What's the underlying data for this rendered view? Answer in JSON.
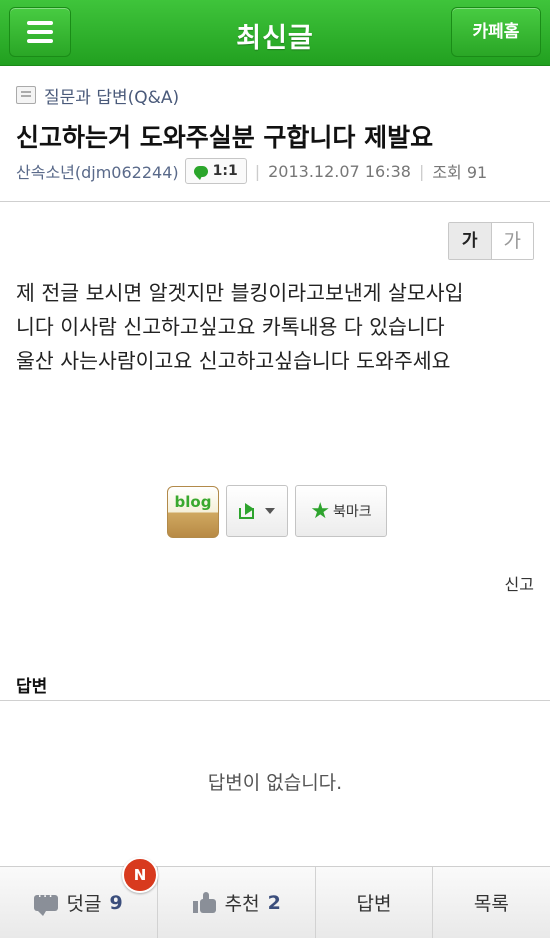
{
  "header": {
    "title": "최신글",
    "home_label": "카페홈"
  },
  "post": {
    "category": "질문과 답변(Q&A)",
    "title": "신고하는거 도와주실분 구합니다 제발요",
    "author": "산속소년(djm062244)",
    "chat_label": "1:1",
    "date": "2013.12.07 16:38",
    "views_label": "조회 91",
    "font_small": "가",
    "font_large": "가",
    "body_lines": [
      "제 전글 보시면 알겟지만 블킹이라고보낸게 살모사입",
      "니다 이사람 신고하고싶고요 카톡내용 다 있습니다",
      "울산 사는사람이고요 신고하고싶습니다 도와주세요"
    ],
    "blog_label": "blog",
    "bookmark_label": "북마크",
    "report_label": "신고"
  },
  "answers": {
    "title": "답변",
    "empty_text": "답변이 없습니다."
  },
  "bottom_bar": {
    "comments_label": "덧글",
    "comments_count": "9",
    "new_badge": "N",
    "recommend_label": "추천",
    "recommend_count": "2",
    "answer_label": "답변",
    "list_label": "목록"
  }
}
